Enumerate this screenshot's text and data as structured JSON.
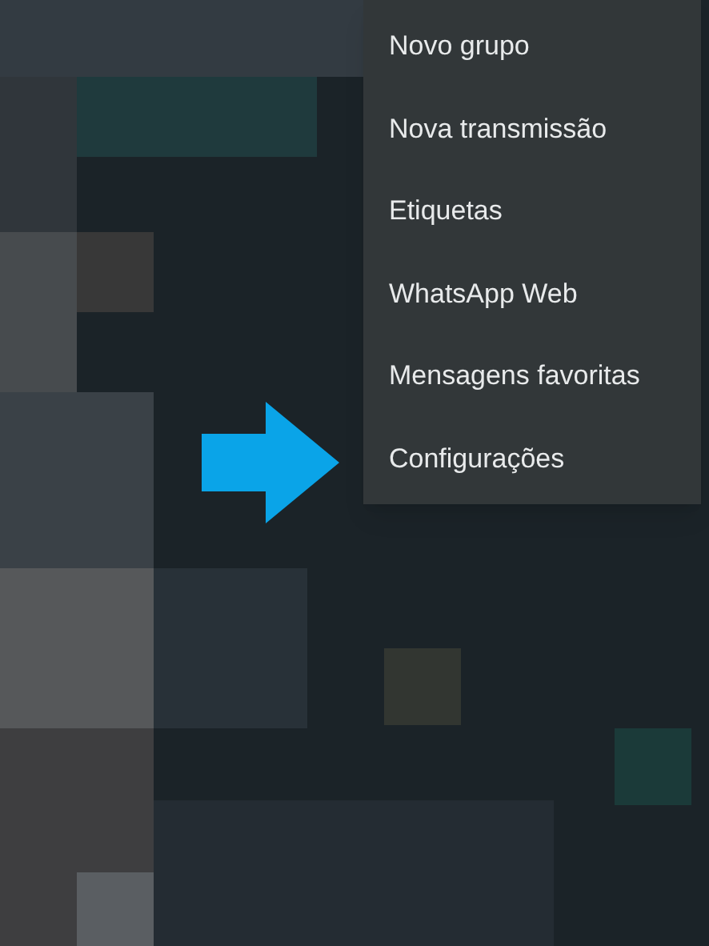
{
  "menu": {
    "items": [
      {
        "label": "Novo grupo"
      },
      {
        "label": "Nova transmissão"
      },
      {
        "label": "Etiquetas"
      },
      {
        "label": "WhatsApp Web"
      },
      {
        "label": "Mensagens favoritas"
      },
      {
        "label": "Configurações"
      }
    ]
  }
}
